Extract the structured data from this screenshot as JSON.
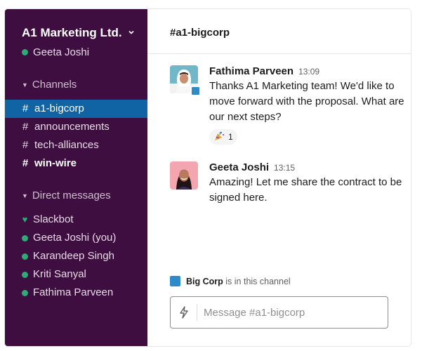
{
  "workspace": {
    "name": "A1 Marketing Ltd.",
    "user_name": "Geeta Joshi"
  },
  "sidebar": {
    "channels_header": "Channels",
    "channels": [
      {
        "name": "a1-bigcorp",
        "active": true,
        "unread": false
      },
      {
        "name": "announcements",
        "active": false,
        "unread": false
      },
      {
        "name": "tech-alliances",
        "active": false,
        "unread": false
      },
      {
        "name": "win-wire",
        "active": false,
        "unread": true
      }
    ],
    "dm_header": "Direct messages",
    "dms": [
      {
        "name": "Slackbot",
        "icon": "heart-icon"
      },
      {
        "name": "Geeta Joshi (you)",
        "icon": "presence-dot"
      },
      {
        "name": "Karandeep Singh",
        "icon": "presence-dot"
      },
      {
        "name": "Kriti Sanyal",
        "icon": "presence-dot"
      },
      {
        "name": "Fathima Parveen",
        "icon": "presence-dot"
      }
    ]
  },
  "main": {
    "channel_title": "#a1-bigcorp",
    "messages": [
      {
        "author": "Fathima Parveen",
        "time": "13:09",
        "text": "Thanks A1 Marketing team! We'd like to move forward with the proposal. What are our next steps?",
        "reaction": {
          "emoji": "party-popper-icon",
          "count": "1"
        }
      },
      {
        "author": "Geeta Joshi",
        "time": "13:15",
        "text": "Amazing! Let me share the contract to be signed here."
      }
    ],
    "external_org": "Big Corp",
    "external_note": "is in this channel",
    "composer_placeholder": "Message #a1-bigcorp"
  },
  "colors": {
    "sidebar_bg": "#3f0e40",
    "active_channel": "#1164a3",
    "presence": "#2bac76",
    "org_badge": "#2f8bc8"
  }
}
